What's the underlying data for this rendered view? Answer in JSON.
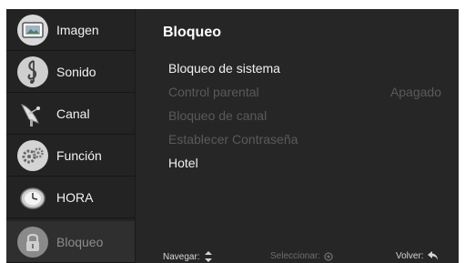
{
  "sidebar": {
    "items": [
      {
        "label": "Imagen",
        "icon": "picture-icon"
      },
      {
        "label": "Sonido",
        "icon": "music-note-icon"
      },
      {
        "label": "Canal",
        "icon": "satellite-dish-icon"
      },
      {
        "label": "Función",
        "icon": "gears-icon"
      },
      {
        "label": "HORA",
        "icon": "clock-icon"
      },
      {
        "label": "Bloqueo",
        "icon": "lock-icon",
        "selected": true
      }
    ]
  },
  "panel": {
    "title": "Bloqueo",
    "items": [
      {
        "label": "Bloqueo de sistema",
        "value": "",
        "enabled": true
      },
      {
        "label": "Control parental",
        "value": "Apagado",
        "enabled": false
      },
      {
        "label": "Bloqueo de canal",
        "value": "",
        "enabled": false
      },
      {
        "label": "Establecer Contraseña",
        "value": "",
        "enabled": false
      },
      {
        "label": "Hotel",
        "value": "",
        "enabled": true
      }
    ]
  },
  "footer": {
    "navigate_label": "Navegar:",
    "select_label": "Seleccionar:",
    "back_label": "Volver:"
  },
  "colors": {
    "background": "#262626",
    "text": "#f0f0f0",
    "disabled_text": "#5a5a5a"
  }
}
